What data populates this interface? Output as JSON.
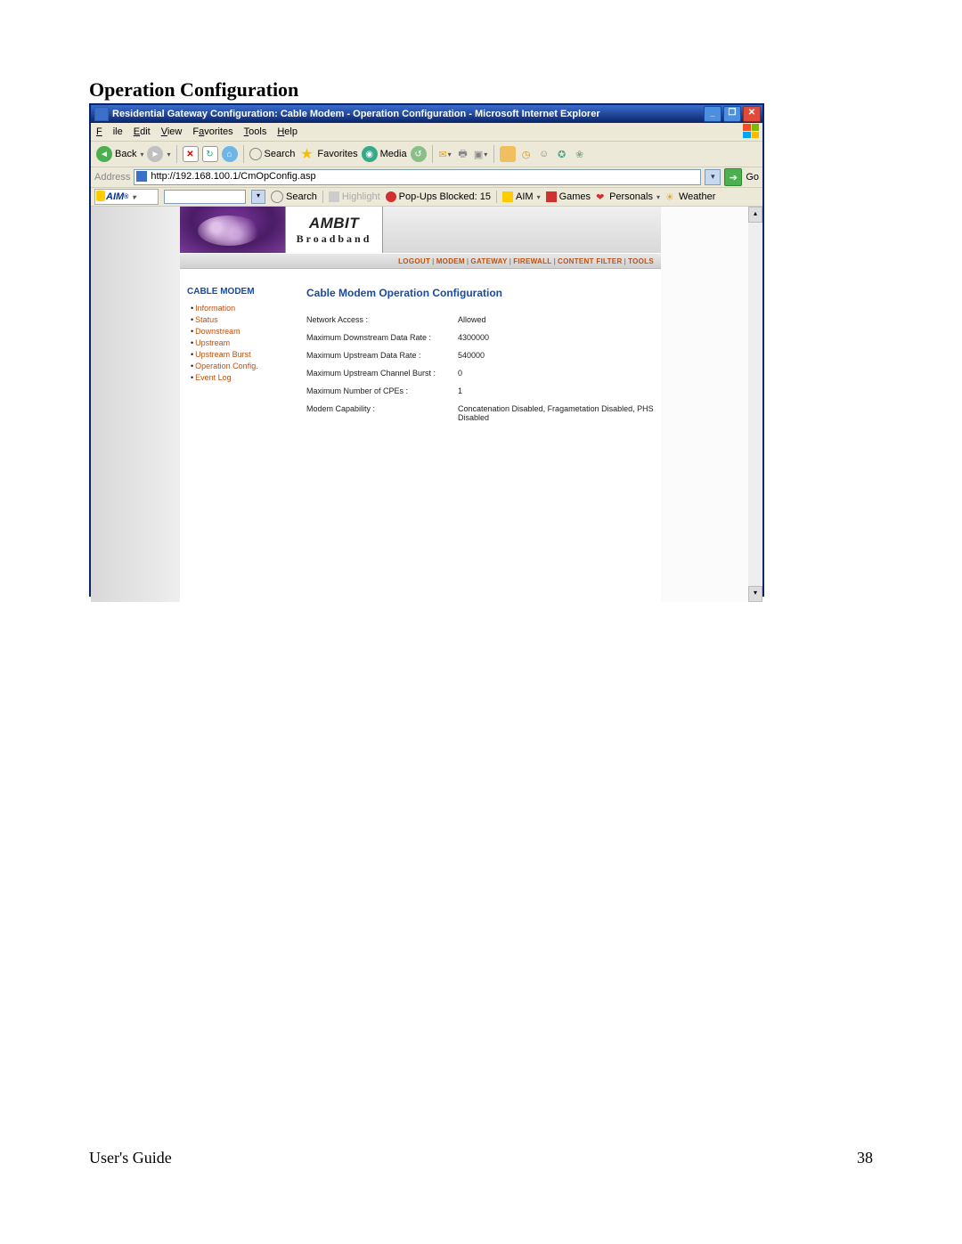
{
  "doc": {
    "heading": "Operation Configuration",
    "footer_left": "User's Guide",
    "footer_right": "38"
  },
  "window": {
    "title": "Residential Gateway Configuration: Cable Modem - Operation Configuration - Microsoft Internet Explorer"
  },
  "menubar": {
    "file": "File",
    "edit": "Edit",
    "view": "View",
    "favorites": "Favorites",
    "tools": "Tools",
    "help": "Help"
  },
  "toolbar": {
    "back": "Back",
    "search": "Search",
    "favorites": "Favorites",
    "media": "Media"
  },
  "address": {
    "label": "Address",
    "url": "http://192.168.100.1/CmOpConfig.asp",
    "go": "Go"
  },
  "aimbar": {
    "logo": "AIM",
    "search": "Search",
    "highlight": "Highlight",
    "popups": "Pop-Ups Blocked: 15",
    "aim": "AIM",
    "games": "Games",
    "personals": "Personals",
    "weather": "Weather"
  },
  "page": {
    "brand_top": "AMBIT",
    "brand_bottom": "Broadband",
    "nav": {
      "logout": "LOGOUT",
      "modem": "MODEM",
      "gateway": "GATEWAY",
      "firewall": "FIREWALL",
      "content_filter": "CONTENT FILTER",
      "tools": "TOOLS"
    },
    "sidebar": {
      "title": "CABLE MODEM",
      "items": [
        "Information",
        "Status",
        "Downstream",
        "Upstream",
        "Upstream Burst",
        "Operation Config.",
        "Event Log"
      ]
    },
    "content": {
      "title": "Cable Modem Operation Configuration",
      "rows": [
        {
          "label": "Network Access :",
          "value": "Allowed"
        },
        {
          "label": "Maximum Downstream Data Rate :",
          "value": "4300000"
        },
        {
          "label": "Maximum Upstream Data Rate :",
          "value": "540000"
        },
        {
          "label": "Maximum Upstream Channel Burst :",
          "value": "0"
        },
        {
          "label": "Maximum Number of CPEs :",
          "value": "1"
        },
        {
          "label": "Modem Capability :",
          "value": "Concatenation Disabled, Fragametation Disabled, PHS Disabled"
        }
      ]
    }
  }
}
